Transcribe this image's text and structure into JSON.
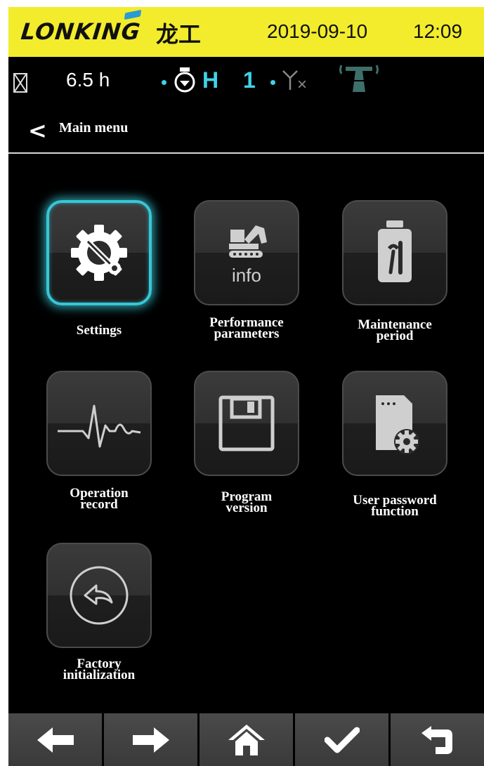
{
  "header": {
    "brand_latin": "LONKING",
    "brand_cn": "龙工",
    "date": "2019-09-10",
    "time": "12:09",
    "bg_color": "#f2ec2c"
  },
  "status": {
    "hours": "6.5 h",
    "work_mode": "H",
    "power_level": "1",
    "accent_color": "#3fd3e8",
    "icons": [
      "hourglass-icon",
      "engine-icon",
      "antenna-no-signal-icon",
      "signal-tower-icon"
    ]
  },
  "breadcrumb": {
    "label": "Main menu"
  },
  "menu": {
    "items": [
      {
        "name": "settings",
        "lines": [
          "Settings"
        ],
        "icon": "gear-wrench-icon",
        "selected": true
      },
      {
        "name": "performance-parameters",
        "lines": [
          "Performance",
          "parameters"
        ],
        "icon": "excavator-info-icon",
        "icon_text": "info"
      },
      {
        "name": "maintenance-period",
        "lines": [
          "Maintenance",
          "period"
        ],
        "icon": "fluid-can-wrench-icon"
      },
      {
        "name": "operation-record",
        "lines": [
          "Operation",
          "record"
        ],
        "icon": "heartbeat-icon"
      },
      {
        "name": "program-version",
        "lines": [
          "Program",
          "version"
        ],
        "icon": "floppy-disk-icon"
      },
      {
        "name": "user-password-function",
        "lines": [
          "User password",
          "function"
        ],
        "icon": "document-gear-icon"
      },
      {
        "name": "factory-initialization",
        "lines": [
          "Factory",
          "initialization"
        ],
        "icon": "undo-circle-icon"
      }
    ]
  },
  "nav": {
    "buttons": [
      "arrow-left-icon",
      "arrow-right-icon",
      "home-icon",
      "checkmark-icon",
      "return-icon"
    ]
  }
}
